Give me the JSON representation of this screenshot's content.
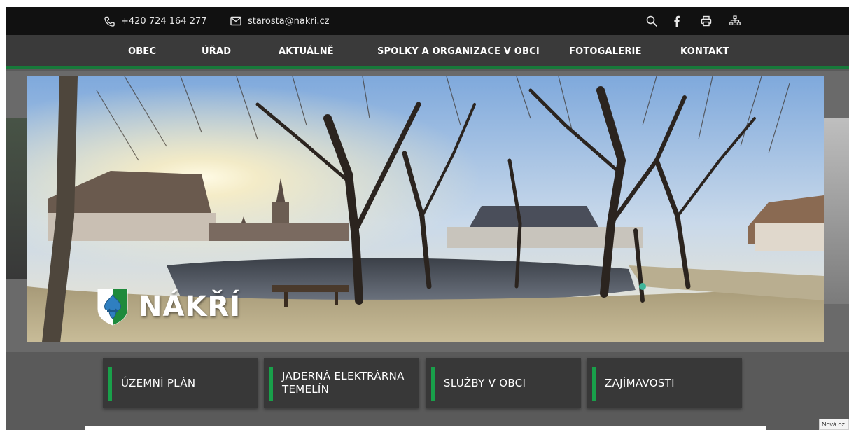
{
  "topbar": {
    "phone": "+420 724 164 277",
    "email": "starosta@nakri.cz",
    "icons": [
      "phone-icon",
      "mail-icon",
      "search-icon",
      "facebook-icon",
      "print-icon",
      "sitemap-icon"
    ]
  },
  "nav": {
    "items": [
      {
        "label": "OBEC"
      },
      {
        "label": "ÚŘAD"
      },
      {
        "label": "AKTUÁLNĚ"
      },
      {
        "label": "SPOLKY A ORGANIZACE V OBCI"
      },
      {
        "label": "FOTOGALERIE"
      },
      {
        "label": "KONTAKT"
      }
    ]
  },
  "hero": {
    "brand_name": "NÁKŘÍ"
  },
  "quick_links": [
    {
      "label": "ÚZEMNÍ PLÁN"
    },
    {
      "label": "JADERNÁ ELEKTRÁRNA TEMELÍN"
    },
    {
      "label": "SLUŽBY V OBCI"
    },
    {
      "label": "ZAJÍMAVOSTI"
    }
  ],
  "tooltip": {
    "text": "Nová oz"
  },
  "colors": {
    "accent_green": "#17793a",
    "tile_bar_green": "#19a04a",
    "topbar_bg": "#111111",
    "nav_bg": "#3a3a3a",
    "tile_bg": "#383838"
  }
}
